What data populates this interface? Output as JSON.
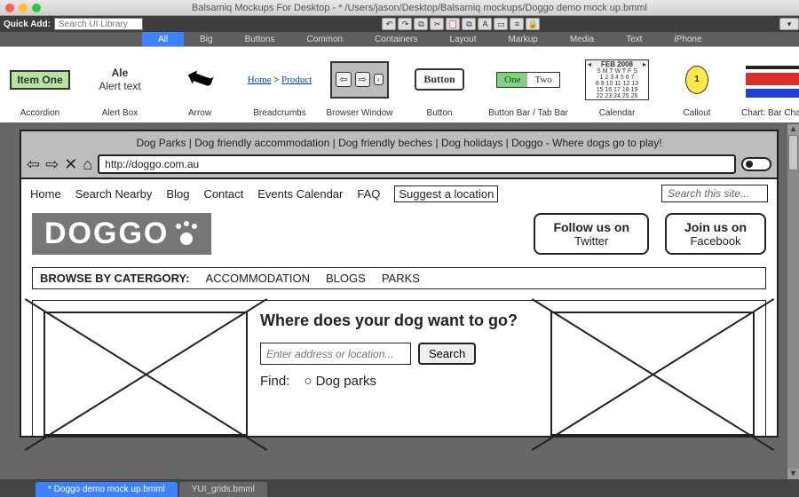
{
  "window": {
    "title": "Balsamiq Mockups For Desktop - * /Users/jason/Desktop/Balsamiq mockups/Doggo demo mock up.bmml"
  },
  "dots": {
    "close": "#ff5f57",
    "min": "#ffbd2e",
    "max": "#28c840"
  },
  "quickadd": {
    "label": "Quick Add:",
    "placeholder": "Search UI Library"
  },
  "categories": [
    "All",
    "Big",
    "Buttons",
    "Common",
    "Containers",
    "Layout",
    "Markup",
    "Media",
    "Text",
    "iPhone"
  ],
  "activeCategory": 0,
  "lib": {
    "accordion": {
      "label": "Accordion",
      "item": "Item One"
    },
    "alert": {
      "label": "Alert Box",
      "title": "Ale",
      "text": "Alert text"
    },
    "arrow": {
      "label": "Arrow"
    },
    "breadcrumbs": {
      "label": "Breadcrumbs",
      "a": "Home",
      "b": "Product"
    },
    "browser": {
      "label": "Browser Window"
    },
    "button": {
      "label": "Button",
      "text": "Button"
    },
    "buttonbar": {
      "label": "Button Bar / Tab Bar",
      "a": "One",
      "b": "Two"
    },
    "calendar": {
      "label": "Calendar",
      "head": "FEB 2008",
      "days": "S M T W T F S"
    },
    "callout": {
      "label": "Callout",
      "n": "1"
    },
    "chart": {
      "label": "Chart: Bar Char"
    }
  },
  "mock": {
    "toplinks": "Dog Parks  |  Dog friendly accommodation  |  Dog friendly beches  |  Dog holidays  |  Doggo - Where dogs go to play!",
    "url": "http://doggo.com.au",
    "nav": [
      "Home",
      "Search Nearby",
      "Blog",
      "Contact",
      "Events Calendar",
      "FAQ",
      "Suggest a location"
    ],
    "search_ph": "Search this site...",
    "logo": "DOGGO",
    "follow": {
      "t": "Follow us on",
      "s": "Twitter"
    },
    "join": {
      "t": "Join us on",
      "s": "Facebook"
    },
    "browse": {
      "l": "BROWSE BY CATERGORY:",
      "a": "ACCOMMODATION",
      "b": "BLOGS",
      "c": "PARKS"
    },
    "q": "Where does your dog want to go?",
    "addr_ph": "Enter address or location...",
    "searchbtn": "Search",
    "find": "Find:",
    "opt1": "Dog parks"
  },
  "tabs": {
    "a": "* Doggo demo mock up.bmml",
    "b": "YUI_grids.bmml"
  }
}
